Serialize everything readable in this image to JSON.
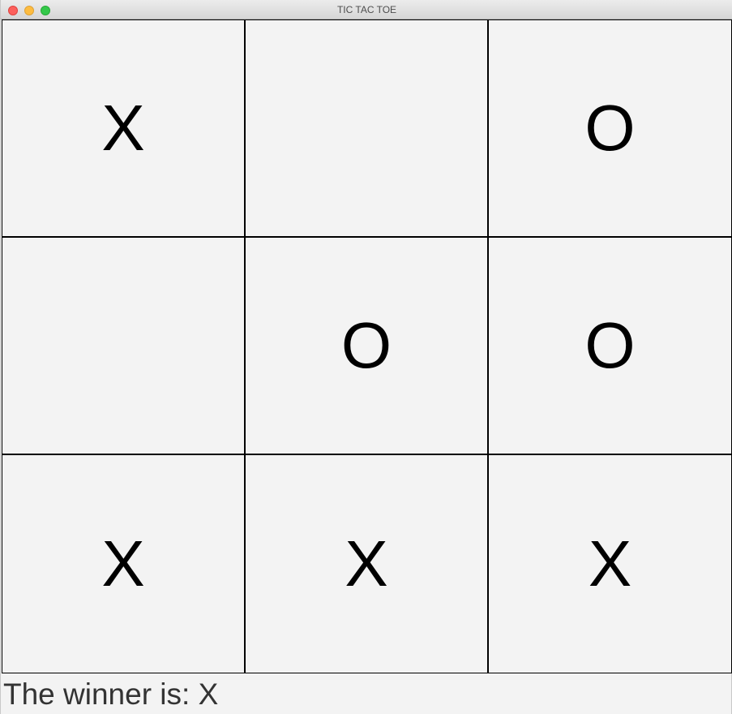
{
  "window": {
    "title": "TIC TAC TOE"
  },
  "board": {
    "cells": [
      [
        "X",
        "",
        "O"
      ],
      [
        "",
        "O",
        "O"
      ],
      [
        "X",
        "X",
        "X"
      ]
    ]
  },
  "status": {
    "text": "The winner is: X"
  }
}
